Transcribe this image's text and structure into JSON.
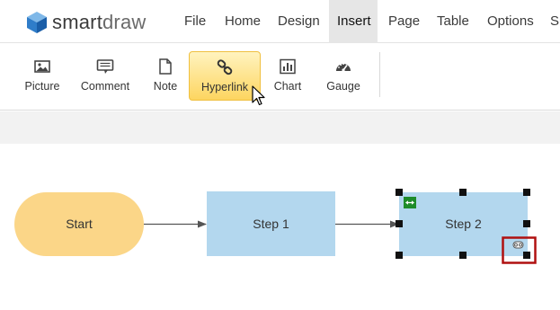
{
  "app": {
    "logo_text_bold": "smart",
    "logo_text_light": "draw"
  },
  "menu": {
    "items": [
      {
        "label": "File"
      },
      {
        "label": "Home"
      },
      {
        "label": "Design"
      },
      {
        "label": "Insert",
        "active": true
      },
      {
        "label": "Page"
      },
      {
        "label": "Table"
      },
      {
        "label": "Options"
      },
      {
        "label": "Su"
      }
    ]
  },
  "ribbon": {
    "tools": [
      {
        "label": "Picture",
        "icon": "picture-icon"
      },
      {
        "label": "Comment",
        "icon": "comment-icon"
      },
      {
        "label": "Note",
        "icon": "note-icon"
      },
      {
        "label": "Hyperlink",
        "icon": "link-icon",
        "selected": true
      },
      {
        "label": "Chart",
        "icon": "chart-icon"
      },
      {
        "label": "Gauge",
        "icon": "gauge-icon"
      }
    ]
  },
  "diagram": {
    "start_label": "Start",
    "step1_label": "Step 1",
    "step2_label": "Step 2",
    "colors": {
      "terminal_fill": "#fbd688",
      "process_fill": "#b3d7ee",
      "connector": "#555555",
      "highlight_box": "#b01010",
      "badge": "#1e8c2a"
    }
  }
}
